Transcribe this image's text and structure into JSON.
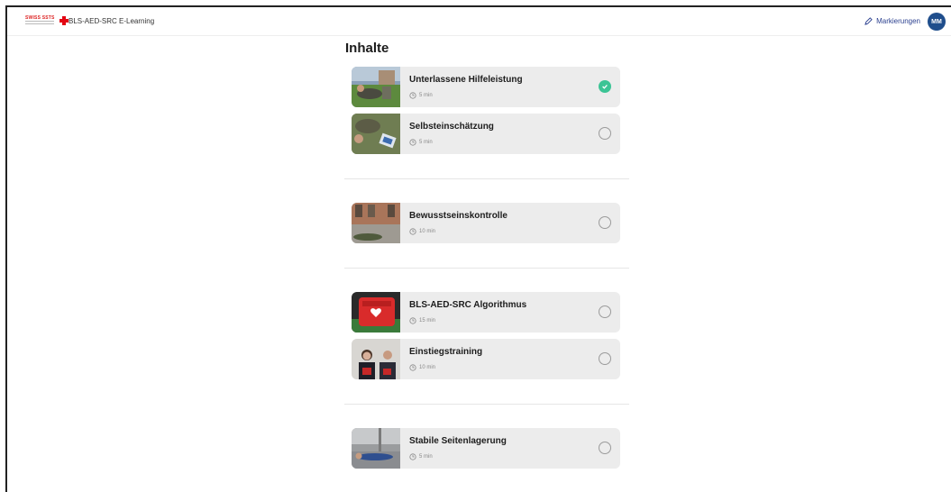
{
  "header": {
    "logo_text": "SWISS SSTS",
    "app_title": "BLS-AED-SRC E-Learning",
    "markings_label": "Markierungen",
    "avatar_initials": "MM"
  },
  "main": {
    "heading": "Inhalte",
    "groups": [
      {
        "items": [
          {
            "title": "Unterlassene Hilfeleistung",
            "duration": "5 min",
            "completed": true,
            "thumb_icon": "outdoor-rescue-photo-icon"
          },
          {
            "title": "Selbsteinschätzung",
            "duration": "5 min",
            "completed": false,
            "thumb_icon": "lying-person-photo-icon"
          }
        ]
      },
      {
        "items": [
          {
            "title": "Bewusstseinskontrolle",
            "duration": "10 min",
            "completed": false,
            "thumb_icon": "street-person-photo-icon"
          }
        ]
      },
      {
        "items": [
          {
            "title": "BLS-AED-SRC Algorithmus",
            "duration": "15 min",
            "completed": false,
            "thumb_icon": "aed-device-photo-icon"
          },
          {
            "title": "Einstiegstraining",
            "duration": "10 min",
            "completed": false,
            "thumb_icon": "trainers-photo-icon"
          }
        ]
      },
      {
        "items": [
          {
            "title": "Stabile Seitenlagerung",
            "duration": "5 min",
            "completed": false,
            "thumb_icon": "recovery-position-photo-icon"
          }
        ]
      }
    ]
  },
  "colors": {
    "accent": "#2a3f8f",
    "avatar": "#1f4e8c",
    "success": "#3cc495",
    "card_bg": "#ececec",
    "brand_red": "#e30613"
  }
}
